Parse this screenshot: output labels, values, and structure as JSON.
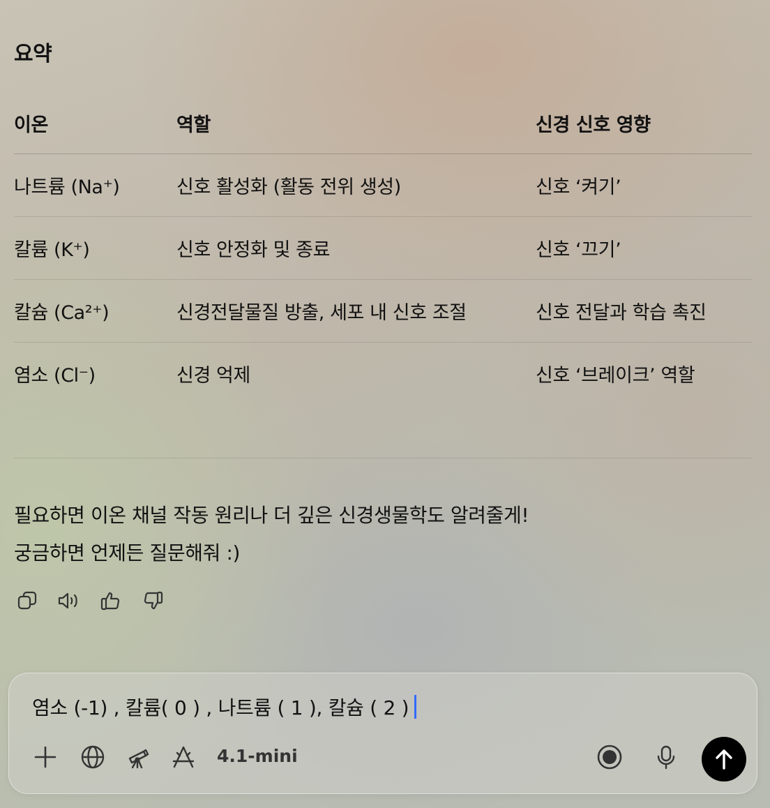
{
  "summary": {
    "heading": "요약"
  },
  "table": {
    "headers": [
      "이온",
      "역할",
      "신경 신호 영향"
    ],
    "rows": [
      [
        "나트륨 (Na⁺)",
        "신호 활성화 (활동 전위 생성)",
        "신호 ‘켜기’"
      ],
      [
        "칼륨 (K⁺)",
        "신호 안정화 및 종료",
        "신호 ‘끄기’"
      ],
      [
        "칼슘 (Ca²⁺)",
        "신경전달물질 방출, 세포 내 신호 조절",
        "신호 전달과 학습 촉진"
      ],
      [
        "염소 (Cl⁻)",
        "신경 억제",
        "신호 ‘브레이크’ 역할"
      ]
    ]
  },
  "message": {
    "line1": "필요하면 이온 채널 작동 원리나 더 깊은 신경생물학도 알려줄게!",
    "line2": "궁금하면 언제든 질문해줘 :)"
  },
  "actions": {
    "icons": [
      "copy-icon",
      "speaker-icon",
      "thumbs-up-icon",
      "thumbs-down-icon"
    ]
  },
  "composer": {
    "input_value": "염소 (-1) , 칼륨( 0 ) , 나트륨 ( 1 ), 칼슘 ( 2 )",
    "model_label": "4.1-mini",
    "icons": [
      "plus-icon",
      "globe-icon",
      "telescope-icon",
      "tools-icon",
      "voice-mode-icon",
      "microphone-icon",
      "send-arrow-icon"
    ],
    "caret_color": "#2f6bff",
    "send_button_color": "#000000"
  }
}
